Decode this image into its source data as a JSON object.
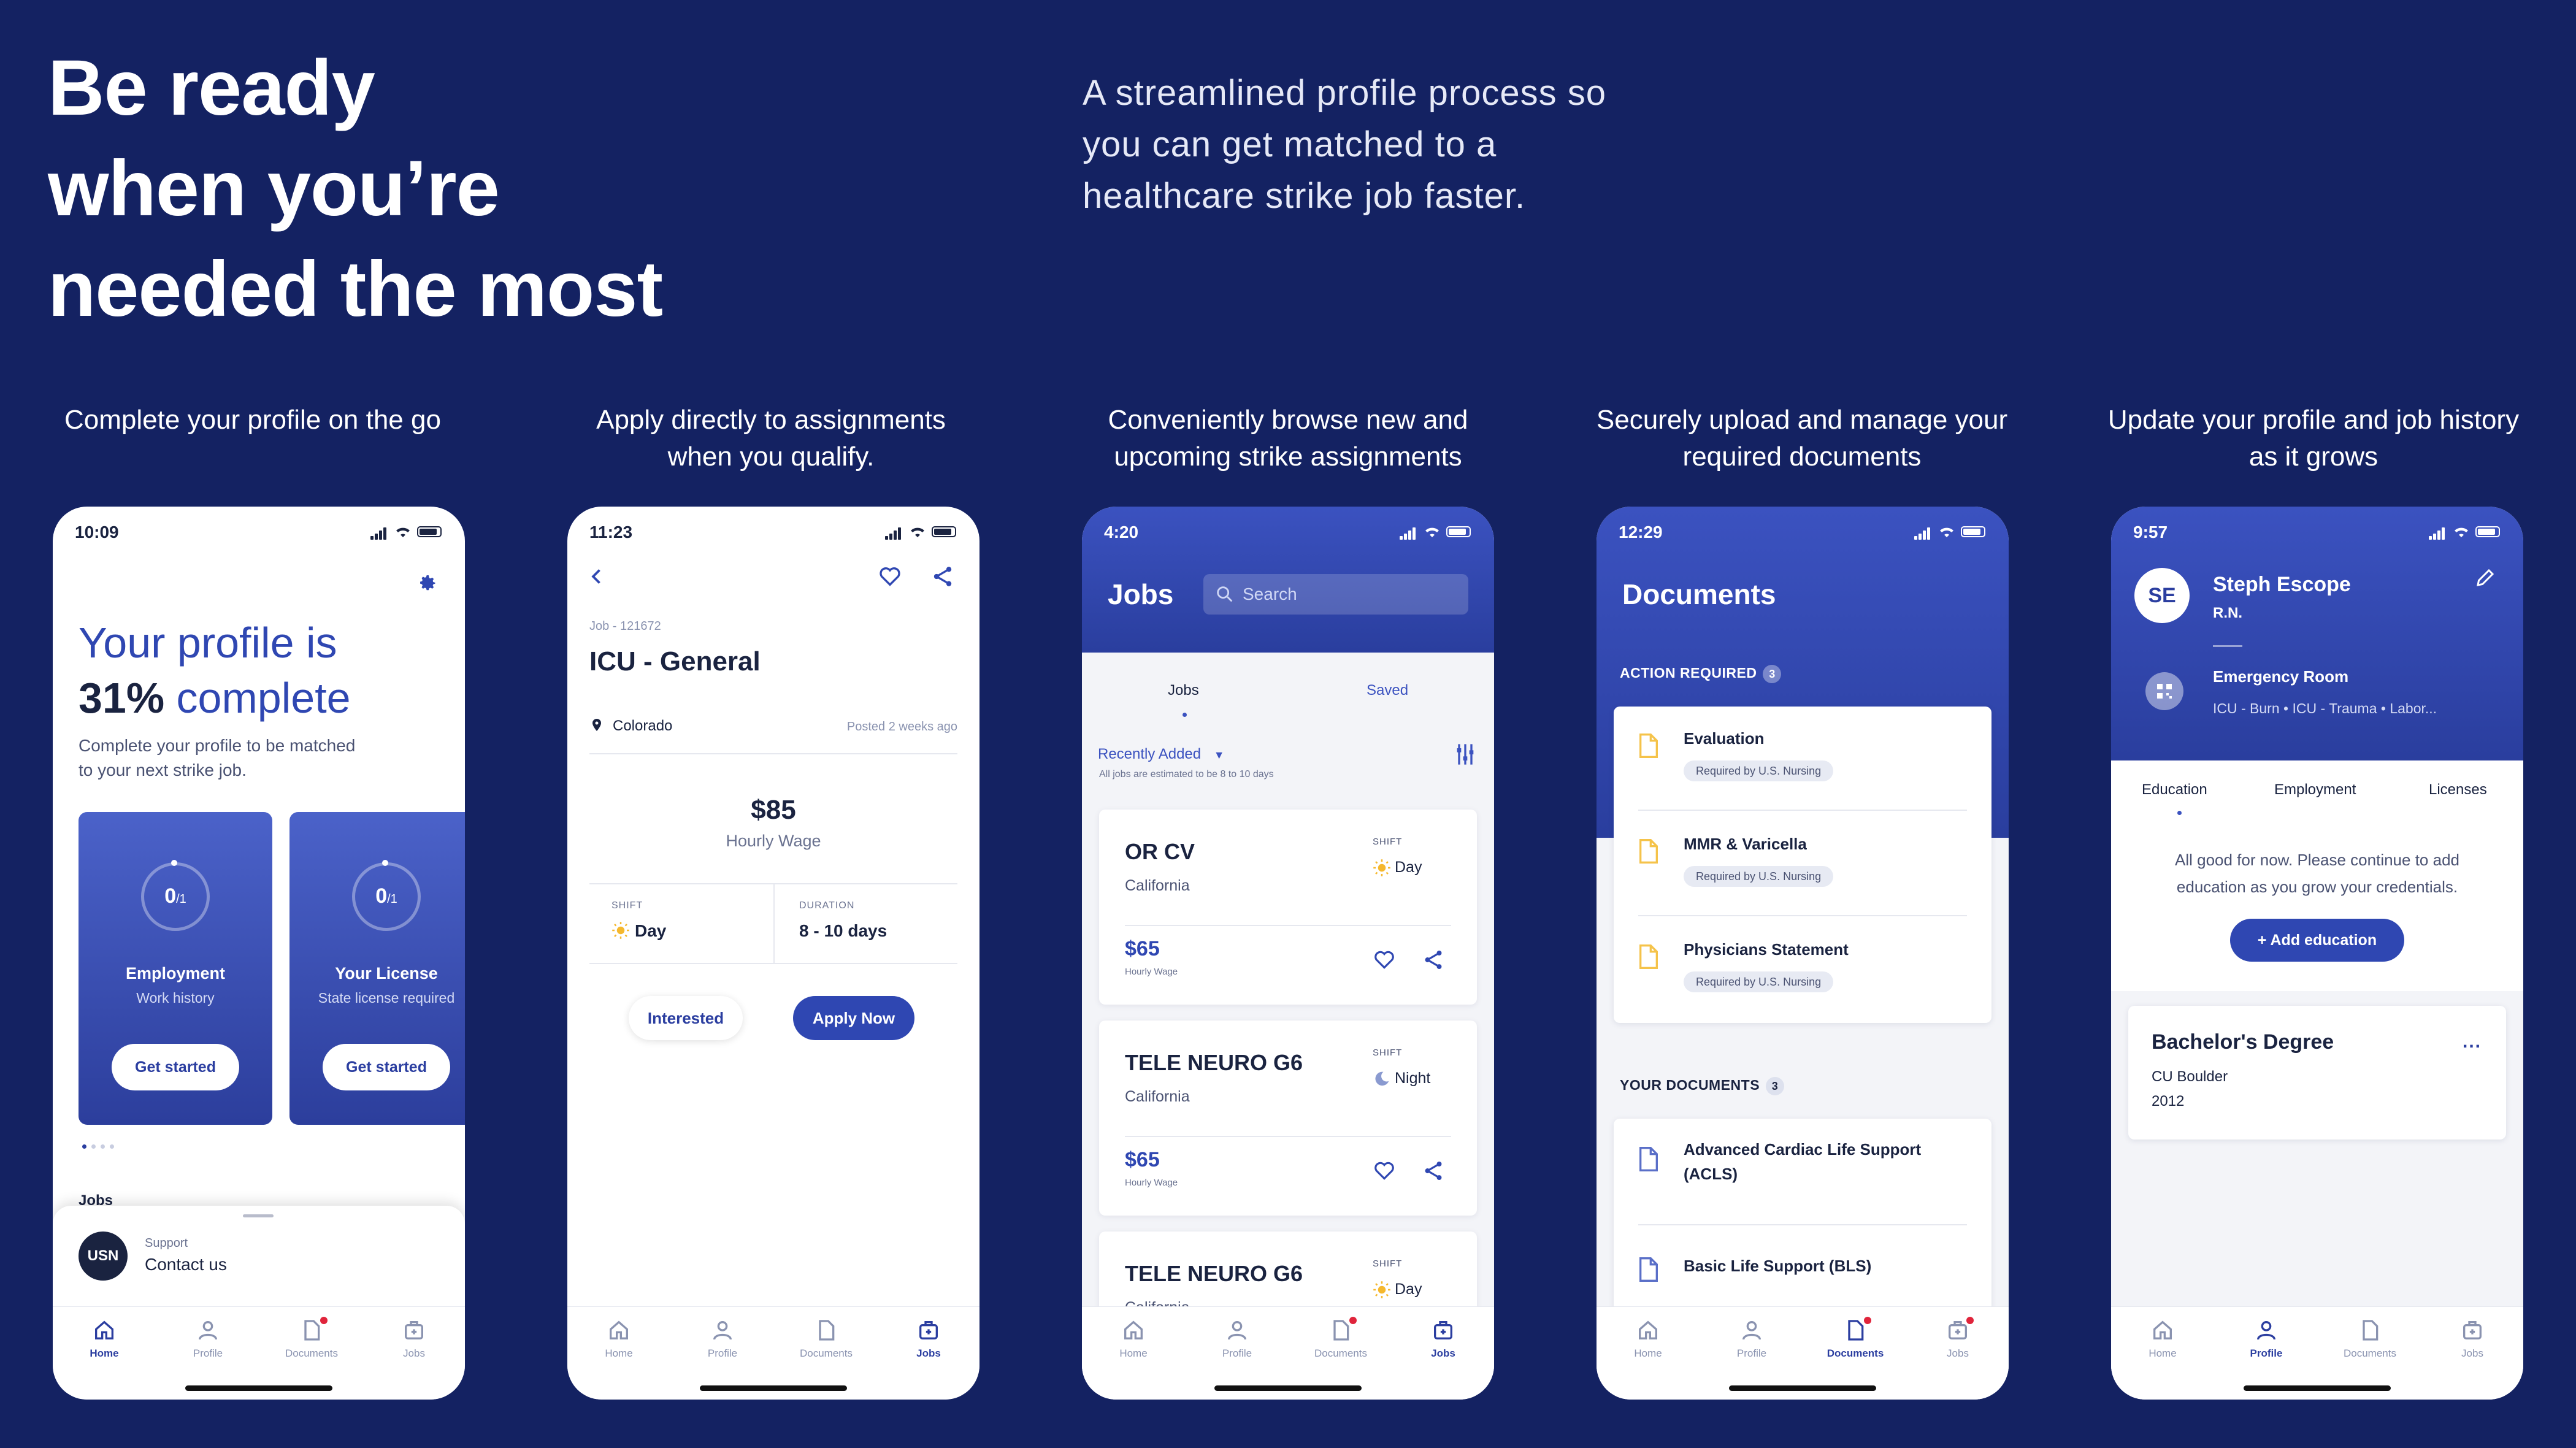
{
  "hero": {
    "headline": [
      "Be ready",
      "when you’re",
      "needed the most"
    ],
    "tagline": [
      "A streamlined profile process so",
      "you can get matched to a",
      "healthcare strike job faster."
    ]
  },
  "captions": [
    [
      "Complete your profile on the go"
    ],
    [
      "Apply directly to assignments",
      "when you qualify."
    ],
    [
      "Conveniently browse new and",
      "upcoming strike assignments"
    ],
    [
      "Securely upload and manage your",
      "required documents"
    ],
    [
      "Update your profile and job history",
      "as it grows"
    ]
  ],
  "tabbar": {
    "home": "Home",
    "profile": "Profile",
    "documents": "Documents",
    "jobs": "Jobs"
  },
  "phone1": {
    "time": "10:09",
    "title_line1": "Your profile is",
    "percent": "31%",
    "title_line2_rest": " complete",
    "subtitle": [
      "Complete your profile to be matched",
      "to your next strike job."
    ],
    "cards": [
      {
        "count": "0",
        "total": "/1",
        "title": "Employment",
        "subtitle": "Work history",
        "button": "Get started"
      },
      {
        "count": "0",
        "total": "/1",
        "title": "Your License",
        "subtitle": "State license required",
        "button": "Get started"
      }
    ],
    "jobs_peek": "Jobs",
    "support": {
      "logo": "USN",
      "label": "Support",
      "action": "Contact us"
    }
  },
  "phone2": {
    "time": "11:23",
    "job_id": "Job - 121672",
    "title": "ICU - General",
    "location": "Colorado",
    "posted": "Posted 2 weeks ago",
    "wage": "$85",
    "wage_label": "Hourly Wage",
    "shift_label": "SHIFT",
    "shift_value": "Day",
    "duration_label": "DURATION",
    "duration_value": "8 - 10 days",
    "interested": "Interested",
    "apply": "Apply Now"
  },
  "phone3": {
    "time": "4:20",
    "title": "Jobs",
    "search_placeholder": "Search",
    "seg_jobs": "Jobs",
    "seg_saved": "Saved",
    "sort": "Recently Added",
    "sort_note": "All jobs are estimated to be 8 to 10 days",
    "shift_label": "SHIFT",
    "jobs": [
      {
        "title": "OR CV",
        "location": "California",
        "shift": "Day",
        "rate": "$65",
        "rate_label": "Hourly Wage"
      },
      {
        "title": "TELE NEURO G6",
        "location": "California",
        "shift": "Night",
        "rate": "$65",
        "rate_label": "Hourly Wage"
      },
      {
        "title": "TELE NEURO G6",
        "location": "California",
        "shift": "Day",
        "rate": "",
        "rate_label": ""
      }
    ]
  },
  "phone4": {
    "time": "12:29",
    "title": "Documents",
    "action_required": "ACTION REQUIRED",
    "action_count": "3",
    "required": [
      {
        "name": "Evaluation",
        "tag": "Required by U.S. Nursing"
      },
      {
        "name": "MMR & Varicella",
        "tag": "Required by U.S. Nursing"
      },
      {
        "name": "Physicians Statement",
        "tag": "Required by U.S. Nursing"
      }
    ],
    "your_documents": "YOUR DOCUMENTS",
    "your_count": "3",
    "docs": [
      [
        "Advanced Cardiac Life Support",
        "(ACLS)"
      ],
      [
        "Basic Life Support (BLS)"
      ]
    ]
  },
  "phone5": {
    "time": "9:57",
    "initials": "SE",
    "name": "Steph Escope",
    "credential": "R.N.",
    "department": "Emergency Room",
    "units": "ICU - Burn  •  ICU - Trauma  •  Labor...",
    "tabs": [
      "Education",
      "Employment",
      "Licenses"
    ],
    "empty": [
      "All good for now. Please continue to add",
      "education as you grow your credentials."
    ],
    "add_button": "+  Add education",
    "education": {
      "degree": "Bachelor's Degree",
      "school": "CU Boulder",
      "year": "2012",
      "more": "..."
    }
  },
  "colors": {
    "background": "#142262",
    "accent": "#2f47b2",
    "alert": "#e0243b"
  }
}
